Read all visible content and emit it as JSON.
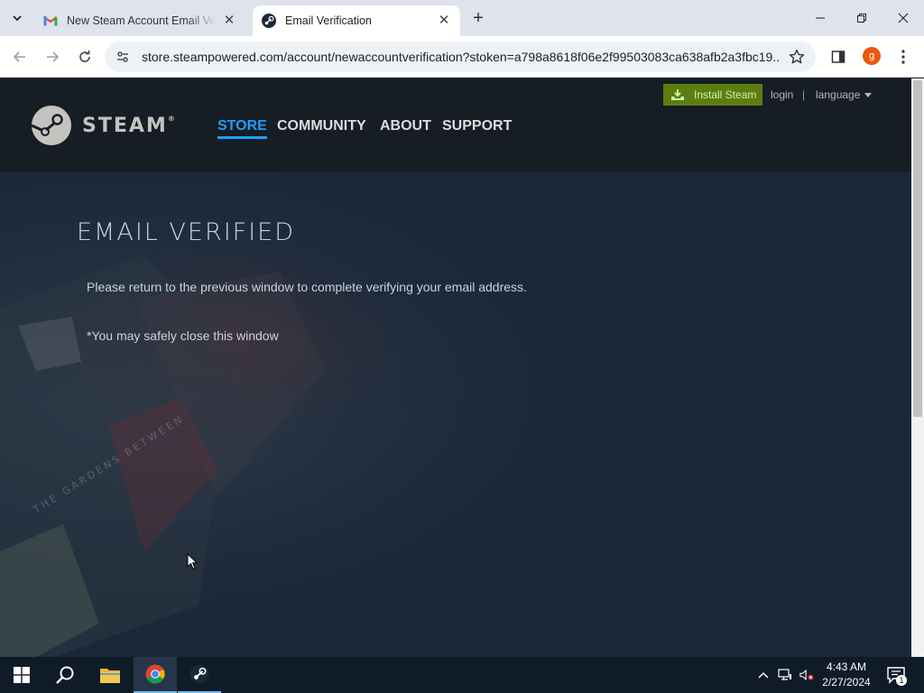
{
  "browser": {
    "tabs": [
      {
        "title": "New Steam Account Email Verification",
        "favicon": "gmail-icon",
        "active": false
      },
      {
        "title": "Email Verification",
        "favicon": "steam-icon",
        "active": true
      }
    ],
    "url": "store.steampowered.com/account/newaccountverification?stoken=a798a8618f06e2f99503083ca638afb2a3fbc19...",
    "profile_initial": "g"
  },
  "steam": {
    "install_label": "Install Steam",
    "login_label": "login",
    "separator": "|",
    "language_label": "language",
    "logo_text": "STEAM",
    "logo_reg": "®",
    "nav": [
      {
        "label": "STORE",
        "active": true
      },
      {
        "label": "COMMUNITY",
        "active": false
      },
      {
        "label": "ABOUT",
        "active": false
      },
      {
        "label": "SUPPORT",
        "active": false
      }
    ],
    "headline": "EMAIL VERIFIED",
    "message": "Please return to the previous window to complete verifying your email address.",
    "note": "*You may safely close this window",
    "bg_art_text": "THE GARDENS BETWEEN"
  },
  "taskbar": {
    "apps": [
      "windows-start",
      "search",
      "file-explorer",
      "chrome",
      "steam"
    ],
    "time": "4:43 AM",
    "date": "2/27/2024",
    "notification_count": "1"
  },
  "colors": {
    "steam_bg": "#1b2838",
    "steam_header": "#171d25",
    "accent_blue": "#1a9fff",
    "install_green": "#5c7e10",
    "text_light": "#c6d4df"
  }
}
